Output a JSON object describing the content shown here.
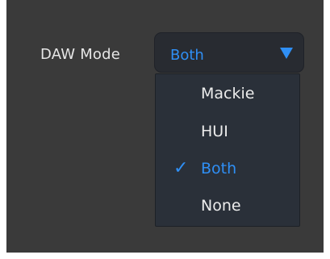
{
  "daw_mode": {
    "label": "DAW Mode",
    "selected_value": "Both",
    "arrow_icon": "triangle-down-icon",
    "accent_color": "#2f8ff5",
    "options": [
      {
        "label": "Mackie",
        "selected": false
      },
      {
        "label": "HUI",
        "selected": false
      },
      {
        "label": "Both",
        "selected": true
      },
      {
        "label": "None",
        "selected": false
      }
    ],
    "check_icon": "checkmark-icon",
    "check_glyph": "✓"
  }
}
